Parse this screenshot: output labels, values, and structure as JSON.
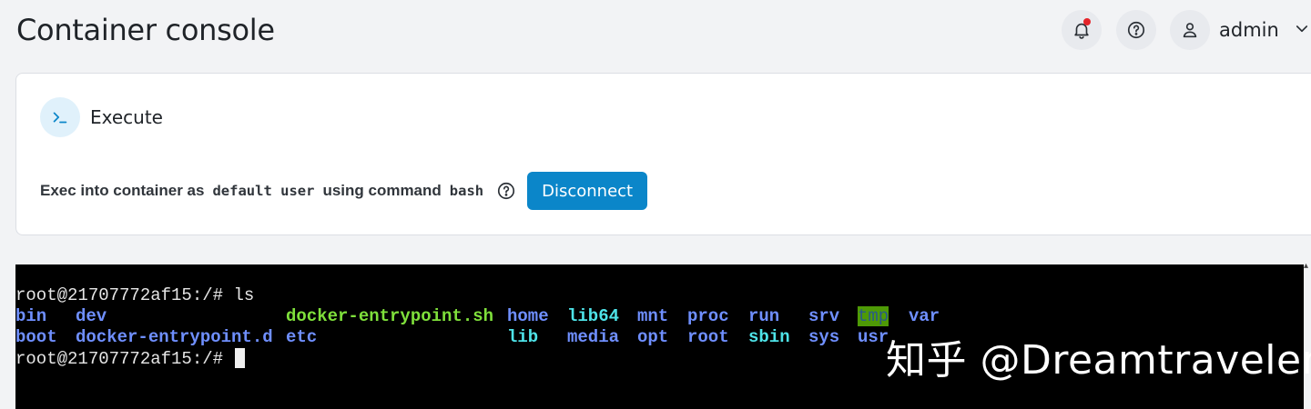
{
  "header": {
    "title": "Container console",
    "username": "admin",
    "icons": {
      "notifications": "bell-icon",
      "help": "help-circle-icon",
      "user": "user-icon",
      "menu": "chevron-down-icon"
    }
  },
  "exec_card": {
    "title": "Execute",
    "icon": "terminal-prompt-icon",
    "text_prefix": "Exec into container as",
    "user_value": "default user",
    "text_middle": "using command",
    "command_value": "bash",
    "disconnect_label": "Disconnect"
  },
  "terminal": {
    "prompt": "root@21707772af15:/#",
    "command": " ls",
    "row1": {
      "bin": "bin",
      "dev": "dev",
      "entry_sh": "docker-entrypoint.sh",
      "home": "home",
      "lib64": "lib64",
      "mnt": "mnt",
      "proc": "proc",
      "run": "run",
      "srv": "srv",
      "tmp": "tmp",
      "var": "var"
    },
    "row2": {
      "boot": "boot",
      "entry_d": "docker-entrypoint.d",
      "etc": "etc",
      "lib": "lib",
      "media": "media",
      "opt": "opt",
      "root": "root",
      "sbin": "sbin",
      "sys": "sys",
      "usr": "usr"
    },
    "colors": {
      "directory": "#6f8fff",
      "executable": "#7fe03b",
      "symlink": "#4ee3e8",
      "sticky_bg": "#4e9a06"
    }
  },
  "watermark": "知乎 @Dreamtraveler",
  "colors": {
    "accent": "#0b86c9",
    "background": "#f2f3f5",
    "terminal_bg": "#000000"
  }
}
